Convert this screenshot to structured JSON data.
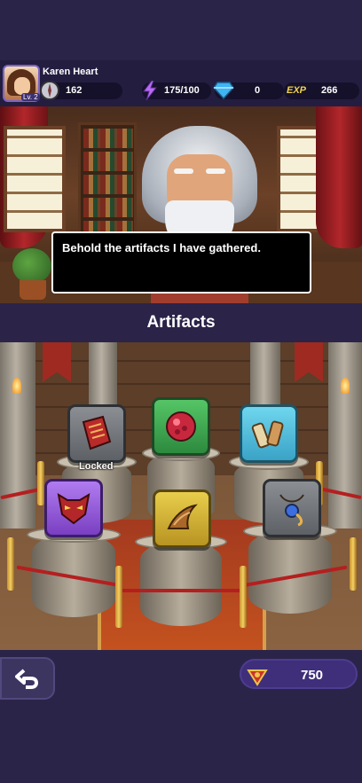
{
  "player": {
    "name": "Karen Heart",
    "level": "Lv. 2"
  },
  "stats": {
    "power": "162",
    "energy": "175/100",
    "gems": "0",
    "exp_label": "EXP",
    "exp": "266"
  },
  "dialog": {
    "text": "Behold the artifacts I have gathered."
  },
  "section": {
    "title": "Artifacts"
  },
  "artifacts": [
    {
      "name": "red-book",
      "rarity": "gray",
      "label": "Locked"
    },
    {
      "name": "crimson-orb",
      "rarity": "green"
    },
    {
      "name": "scrolls",
      "rarity": "cyan"
    },
    {
      "name": "demon-mask",
      "rarity": "purple"
    },
    {
      "name": "golden-horn",
      "rarity": "yellow"
    },
    {
      "name": "amulet",
      "rarity": "gray"
    }
  ],
  "currency": {
    "amount": "750",
    "icon": "artifact-token-icon"
  },
  "colors": {
    "background": "#2a2347",
    "accent_purple": "#3f2f7a",
    "gold": "#e8cd4c"
  }
}
